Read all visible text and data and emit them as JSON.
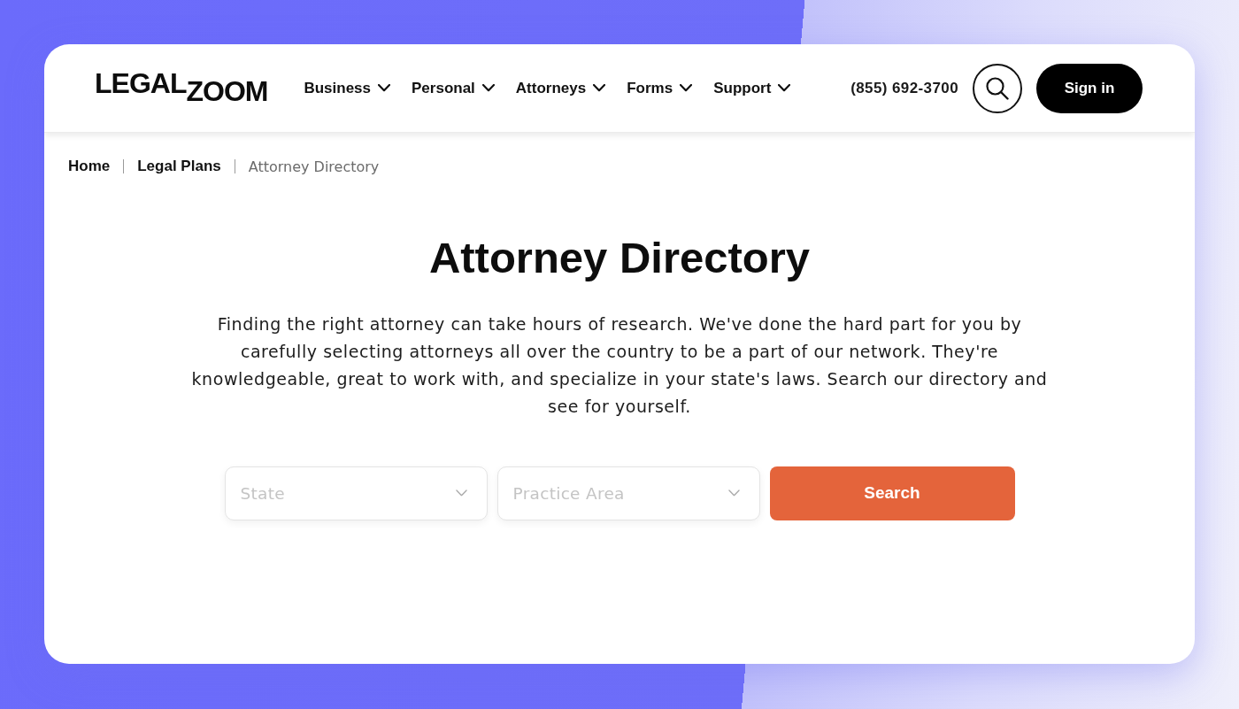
{
  "header": {
    "logo": "LEGAL$_{ZOOM}$",
    "nav": [
      "Business",
      "Personal",
      "Attorneys",
      "Forms",
      "Support"
    ],
    "phone": "(855) 692-3700",
    "sign_in": "Sign in"
  },
  "breadcrumb": [
    {
      "label": "Home",
      "current": false
    },
    {
      "label": "Legal Plans",
      "current": false
    },
    {
      "label": "Attorney Directory",
      "current": true
    }
  ],
  "title": "Attorney Directory",
  "intro": "Finding the right attorney can take hours of research. We've done the hard part for you by carefully selecting attorneys all over the country to be a part of our network. They're knowledgeable, great to work with, and specialize in your state's laws. Search our directory and see for yourself.",
  "search_form": {
    "fields": [
      {
        "placeholder": "State"
      },
      {
        "placeholder": "Practice Area"
      }
    ],
    "button": "Search"
  }
}
